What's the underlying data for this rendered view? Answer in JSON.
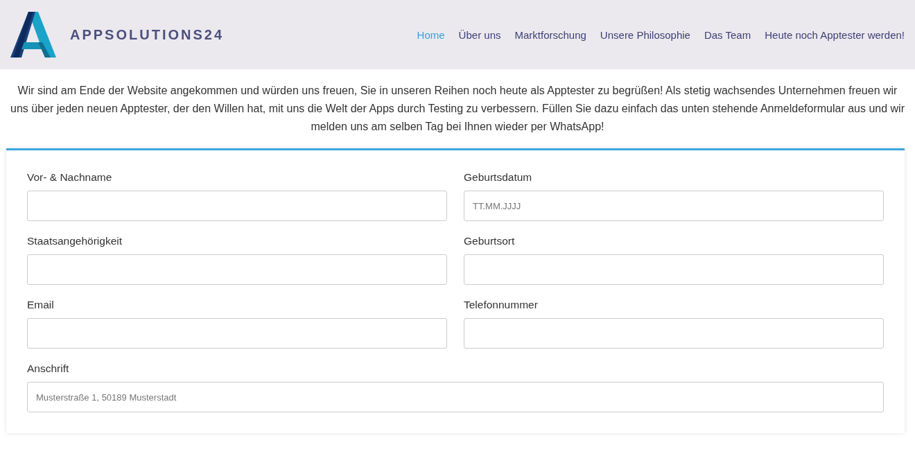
{
  "header": {
    "brand": "APPSOLUTIONS24"
  },
  "nav": [
    {
      "label": "Home",
      "selected": true
    },
    {
      "label": "Über uns",
      "selected": false
    },
    {
      "label": "Marktforschung",
      "selected": false
    },
    {
      "label": "Unsere Philosophie",
      "selected": false
    },
    {
      "label": "Das Team",
      "selected": false
    },
    {
      "label": "Heute noch Apptester werden!",
      "selected": false
    }
  ],
  "intro": "Wir sind am Ende der Website angekommen und würden uns freuen, Sie in unseren Reihen noch heute als Apptester zu begrüßen! Als stetig wachsendes Unternehmen freuen wir uns über jeden neuen Apptester, der den Willen hat, mit uns die Welt der Apps durch Testing zu verbessern. Füllen Sie dazu einfach das unten stehende Anmeldeformular aus und wir melden uns am selben Tag bei Ihnen wieder per WhatsApp!",
  "form": {
    "fields": [
      {
        "kind": "half",
        "label": "Vor- & Nachname"
      },
      {
        "kind": "half",
        "label": "Geburtsdatum",
        "placeholder": "TT.MM.JJJJ"
      },
      {
        "kind": "half",
        "label": "Staatsangehörigkeit"
      },
      {
        "kind": "half",
        "label": "Geburtsort"
      },
      {
        "kind": "half",
        "label": "Email"
      },
      {
        "kind": "half",
        "label": "Telefonnummer"
      },
      {
        "kind": "full",
        "label": "Anschrift",
        "placeholder": "Musterstraße 1, 50189 Musterstadt"
      }
    ]
  }
}
